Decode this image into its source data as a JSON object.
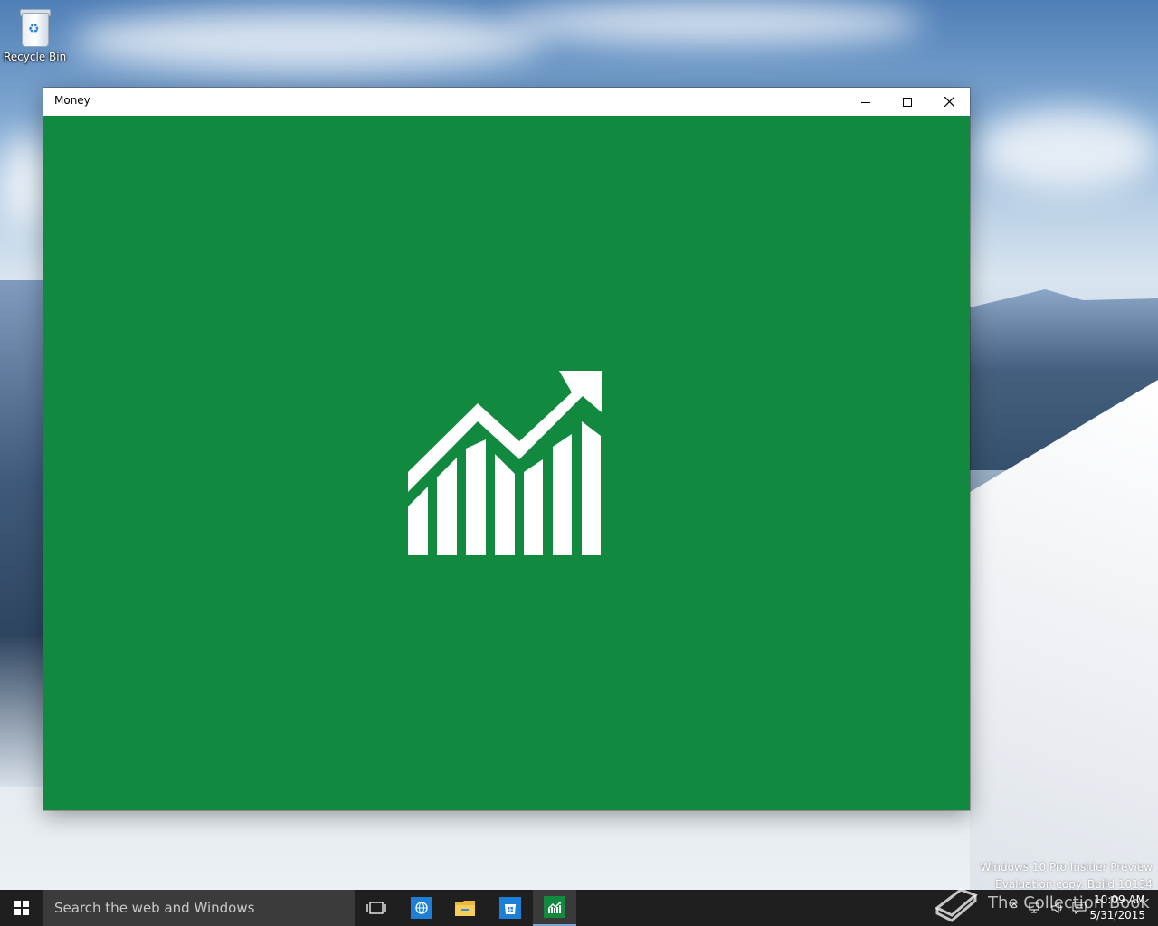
{
  "desktop": {
    "recycle_bin_label": "Recycle Bin"
  },
  "window": {
    "title": "Money",
    "background_color": "#118a3f",
    "logo_icon": "stock-chart-rising-icon"
  },
  "watermark": {
    "line1": "Windows 10 Pro Insider Preview",
    "line2": "Evaluation copy. Build 10134",
    "site": "The Collection Book"
  },
  "taskbar": {
    "search_placeholder": "Search the web and Windows",
    "apps": [
      {
        "name": "task-view-icon"
      },
      {
        "name": "edge-browser-icon"
      },
      {
        "name": "file-explorer-icon"
      },
      {
        "name": "store-icon"
      },
      {
        "name": "money-app-icon",
        "active": true
      }
    ],
    "clock_time": "10:09 AM",
    "clock_date": "5/31/2015"
  }
}
